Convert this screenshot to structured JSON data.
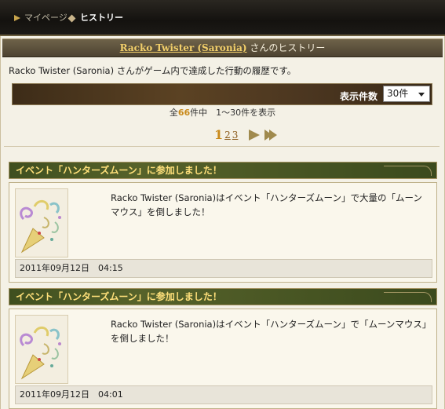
{
  "nav": {
    "breadcrumb": [
      {
        "label": "マイページ",
        "icon": "arrow-icon"
      },
      {
        "label": "ヒストリー",
        "icon": "diamond-icon"
      }
    ]
  },
  "page": {
    "title_name": "Racko Twister (Saronia)",
    "title_suffix": " さんのヒストリー",
    "description": "Racko Twister (Saronia) さんがゲーム内で達成した行動の履歴です。"
  },
  "filter": {
    "label": "表示件数",
    "selected": "30件"
  },
  "summary": {
    "prefix": "全",
    "total": "66",
    "suffix": "件中　1～30件を表示"
  },
  "pager": {
    "current": "1",
    "pages": [
      "2",
      "3"
    ]
  },
  "entries": [
    {
      "title": "イベント「ハンターズムーン」に参加しました！",
      "text": "Racko Twister (Saronia)はイベント「ハンターズムーン」で大量の「ムーンマウス」を倒しました！",
      "date": "2011年09月12日　04:15"
    },
    {
      "title": "イベント「ハンターズムーン」に参加しました！",
      "text": "Racko Twister (Saronia)はイベント「ハンターズムーン」で「ムーンマウス」を倒しました！",
      "date": "2011年09月12日　04:01"
    }
  ],
  "colors": {
    "accent_gold": "#c98a1b",
    "entry_header_green": "#3f4f1f",
    "entry_title_yellow": "#ffe07a"
  }
}
